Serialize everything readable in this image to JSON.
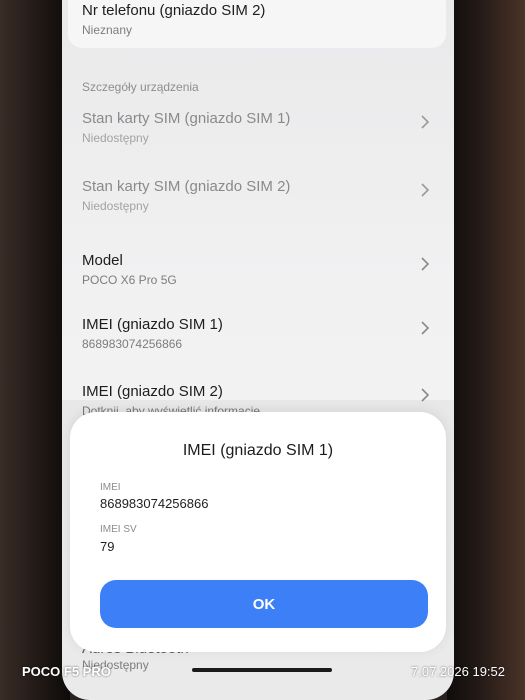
{
  "list": {
    "phone_sim2": {
      "title": "Nr telefonu (gniazdo SIM 2)",
      "subtitle": "Nieznany"
    },
    "section_header": "Szczegóły urządzenia",
    "items": [
      {
        "title": "Stan karty SIM (gniazdo SIM 1)",
        "subtitle": "Niedostępny"
      },
      {
        "title": "Stan karty SIM (gniazdo SIM 2)",
        "subtitle": "Niedostępny"
      },
      {
        "title": "Model",
        "subtitle": "POCO X6 Pro 5G"
      },
      {
        "title": "IMEI (gniazdo SIM 1)",
        "subtitle": "868983074256866"
      },
      {
        "title": "IMEI (gniazdo SIM 2)",
        "subtitle": "Dotknij, aby wyświetlić informacje"
      }
    ],
    "behind_dialog": {
      "title": "Adres Bluetooth",
      "subtitle": "Niedostępny"
    }
  },
  "dialog": {
    "title": "IMEI (gniazdo SIM 1)",
    "fields": [
      {
        "label": "IMEI",
        "value": "868983074256866"
      },
      {
        "label": "IMEI SV",
        "value": "79"
      }
    ],
    "ok_label": "OK"
  },
  "photo_watermark": {
    "device": "POCO F5 PRO",
    "datetime": "7.07.2026 19:52"
  },
  "colors": {
    "accent_button": "#3d7ff7",
    "screen_background": "#f1f1f2",
    "dialog_background": "#ffffff"
  }
}
